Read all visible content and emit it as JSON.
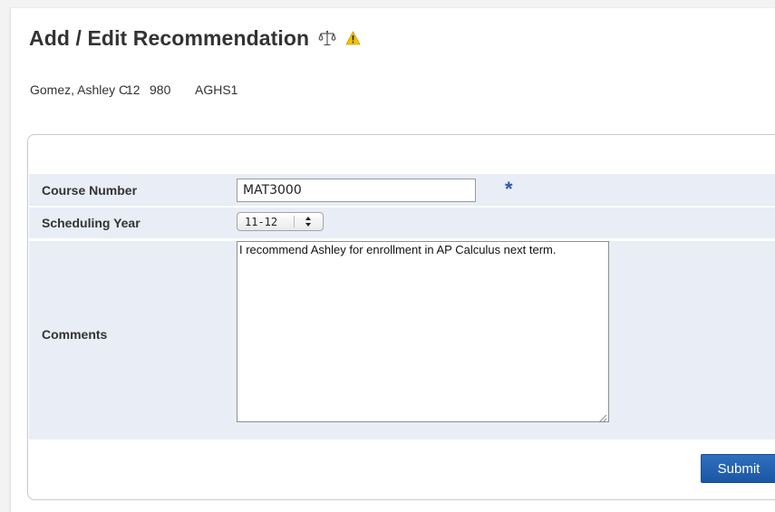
{
  "header": {
    "title": "Add / Edit Recommendation",
    "icons": [
      "scales-icon",
      "warning-icon"
    ]
  },
  "student": {
    "name": "Gomez, Ashley C",
    "grade": "12",
    "id": "980",
    "school": "AGHS1"
  },
  "form": {
    "course_number": {
      "label": "Course Number",
      "value": "MAT3000",
      "required_marker": "*"
    },
    "scheduling_year": {
      "label": "Scheduling Year",
      "selected": "11-12"
    },
    "comments": {
      "label": "Comments",
      "value": "I recommend Ashley for enrollment in AP Calculus next term."
    },
    "submit_label": "Submit"
  },
  "colors": {
    "row_background": "#e8edf6",
    "accent": "#1b57a3",
    "required_star": "#2c5aa0",
    "warning": "#f5c400"
  }
}
